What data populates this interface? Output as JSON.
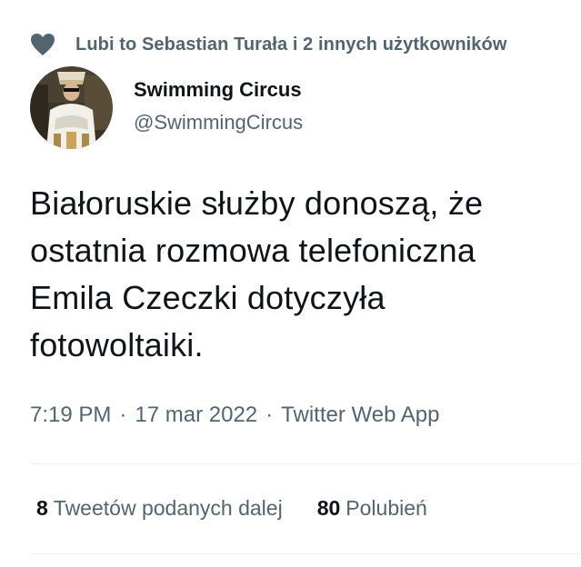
{
  "social_context": {
    "icon": "heart-icon",
    "text": "Lubi to Sebastian Turała i 2 innych użytkowników"
  },
  "author": {
    "display_name": "Swimming Circus",
    "handle": "@SwimmingCircus",
    "avatar": "avatar-photo"
  },
  "tweet": {
    "lines": [
      "Białoruskie służby donoszą, że",
      "ostatnia rozmowa telefoniczna",
      "Emila Czeczki dotyczyła",
      "fotowoltaiki."
    ]
  },
  "meta": {
    "time": "7:19 PM",
    "separator": "·",
    "date": "17 mar 2022",
    "source": "Twitter Web App"
  },
  "stats": {
    "retweets_count": "8",
    "retweets_label": "Tweetów podanych dalej",
    "likes_count": "80",
    "likes_label": "Polubień"
  },
  "colors": {
    "text_primary": "#0f1419",
    "text_secondary": "#536471",
    "divider": "#eff3f4"
  }
}
